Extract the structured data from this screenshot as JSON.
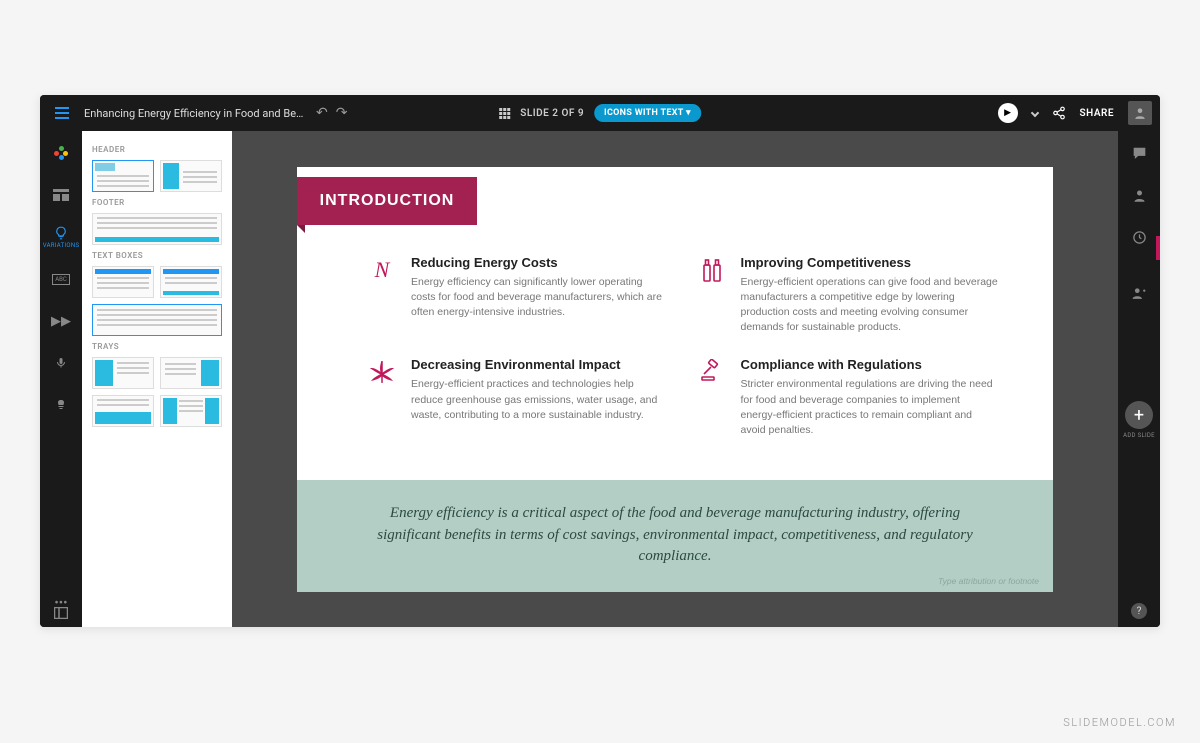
{
  "doc_title": "Enhancing Energy Efficiency in Food and Beverage Manufactu...",
  "slide_indicator": "SLIDE 2 OF 9",
  "layout_pill": "ICONS WITH TEXT ▾",
  "share_label": "SHARE",
  "left_rail": {
    "variations_label": "VARIATIONS",
    "abc_label": "ABC"
  },
  "variations": {
    "sections": {
      "header": "HEADER",
      "footer": "FOOTER",
      "text_boxes": "TEXT BOXES",
      "trays": "TRAYS"
    }
  },
  "slide": {
    "title": "INTRODUCTION",
    "features": [
      {
        "icon": "N",
        "title": "Reducing Energy Costs",
        "desc": "Energy efficiency can significantly lower operating costs for food and beverage manufacturers, which are often energy-intensive industries."
      },
      {
        "icon": "bottles",
        "title": "Improving Competitiveness",
        "desc": "Energy-efficient operations can give food and beverage manufacturers a competitive edge by lowering production costs and meeting evolving consumer demands for sustainable products."
      },
      {
        "icon": "cannabis",
        "title": "Decreasing Environmental Impact",
        "desc": "Energy-efficient practices and technologies help reduce greenhouse gas emissions, water usage, and waste, contributing to a more sustainable industry."
      },
      {
        "icon": "gavel",
        "title": "Compliance with Regulations",
        "desc": "Stricter environmental regulations are driving the need for food and beverage companies to implement energy-efficient practices to remain compliant and avoid penalties."
      }
    ],
    "summary": "Energy efficiency is a critical aspect of the food and beverage manufacturing industry, offering significant benefits in terms of cost savings, environmental impact, competitiveness, and regulatory compliance.",
    "footnote": "Type attribution or footnote"
  },
  "right_rail": {
    "add_slide": "ADD SLIDE"
  },
  "watermark": "SLIDEMODEL.COM"
}
